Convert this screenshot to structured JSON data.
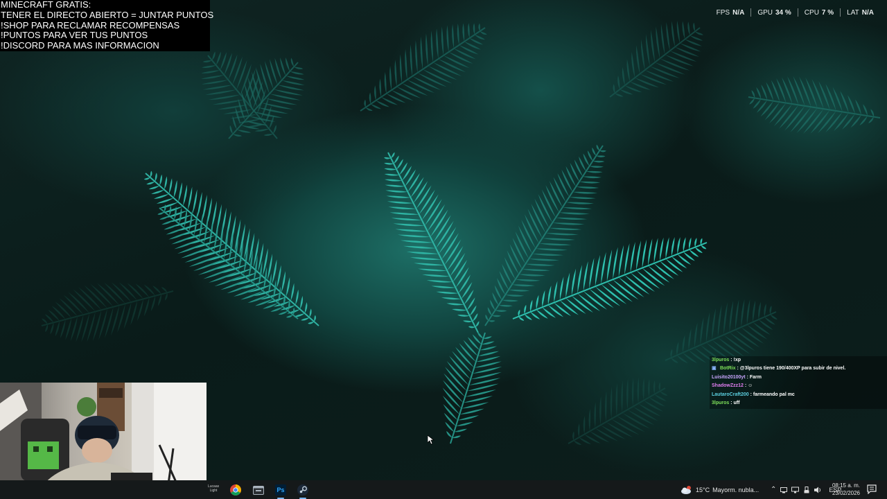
{
  "overlay": {
    "lines": [
      "MINECRAFT GRATIS:",
      "TENER EL DIRECTO ABIERTO = JUNTAR PUNTOS",
      "!SHOP PARA RECLAMAR RECOMPENSAS",
      "!PUNTOS PARA VER TUS PUNTOS",
      "!DISCORD PARA MAS INFORMACION"
    ]
  },
  "perf": [
    {
      "label": "FPS",
      "value": "N/A"
    },
    {
      "label": "GPU",
      "value": "34 %"
    },
    {
      "label": "CPU",
      "value": "7 %"
    },
    {
      "label": "LAT",
      "value": "N/A"
    }
  ],
  "chat": {
    "messages": [
      {
        "user": "3lpuros",
        "text": ": !xp",
        "color": "#7ee05a",
        "badges": false
      },
      {
        "user": "BotRix",
        "text": ": @3lpuros tiene 190/400XP para subir de nivel.",
        "color": "#7ee05a",
        "badges": true
      },
      {
        "user": "Luisito20100yt",
        "text": ": Farm",
        "color": "#c9a6ff",
        "badges": false
      },
      {
        "user": "ShadowZzz12",
        "text": ": ",
        "color": "#e07ef0",
        "badges": false
      },
      {
        "user": "LautaroCraft200",
        "text": ": farmeando pal mc",
        "color": "#5cd0e0",
        "badges": false
      },
      {
        "user": "3lpuros",
        "text": ": uff",
        "color": "#7ee05a",
        "badges": false
      }
    ]
  },
  "taskbar": {
    "widget_label": "Lucaas Light",
    "apps": [
      {
        "name": "chrome",
        "icon": "chrome-icon"
      },
      {
        "name": "files",
        "icon": "app-icon"
      },
      {
        "name": "photoshop",
        "icon": "photoshop-icon",
        "text": "Ps"
      },
      {
        "name": "steam",
        "icon": "steam-icon"
      }
    ],
    "weather": {
      "temp": "15°C",
      "desc": "Mayorm. nubla..."
    },
    "tray": {
      "language": "ESP"
    },
    "clock": {
      "time": "08:15 a. m.",
      "date": "23/02/2026"
    }
  },
  "colors": {
    "accent": "#7ab8f5",
    "taskbar_bg": "#15191a",
    "fern": "#2fb3a3"
  }
}
